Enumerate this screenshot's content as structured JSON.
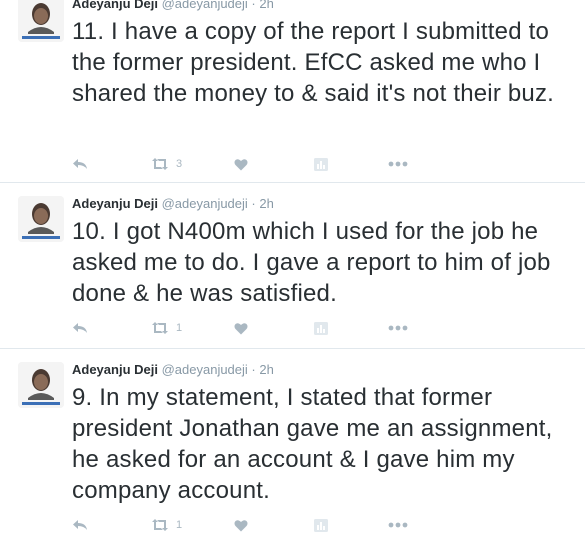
{
  "tweets": [
    {
      "author_name": "Adeyanju Deji",
      "handle": "@adeyanjudeji",
      "separator": "·",
      "time": "2h",
      "text": "11. I have a copy of the report I submitted to the former president. EfCC asked me who I shared the money to & said it's not their buz.",
      "retweet_count": "3"
    },
    {
      "author_name": "Adeyanju Deji",
      "handle": "@adeyanjudeji",
      "separator": "·",
      "time": "2h",
      "text": "10. I got N400m which I used for the job he asked me to do. I gave a report to him of job done & he was satisfied.",
      "retweet_count": "1"
    },
    {
      "author_name": "Adeyanju Deji",
      "handle": "@adeyanjudeji",
      "separator": "·",
      "time": "2h",
      "text": "9. In my statement, I stated that former president Jonathan gave me an assignment, he asked for an account & I gave him my company account.",
      "retweet_count": "1"
    }
  ],
  "icons": {
    "reply": "reply-icon",
    "retweet": "retweet-icon",
    "like": "heart-icon",
    "analytics": "analytics-icon",
    "more": "more-icon"
  },
  "colors": {
    "text": "#292f33",
    "muted": "#8899a6",
    "icon": "#aab8c2",
    "divider": "#e1e8ed"
  }
}
